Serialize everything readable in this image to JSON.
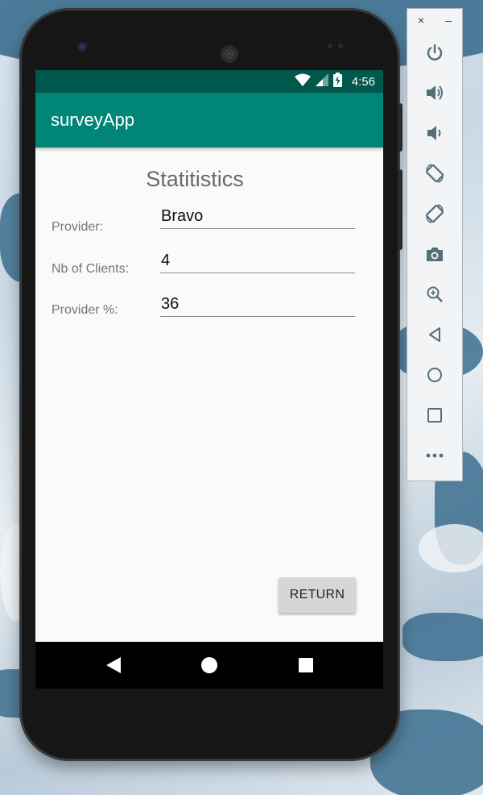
{
  "status_bar": {
    "time": "4:56",
    "icons": [
      "wifi-icon",
      "cell-signal-icon",
      "battery-charging-icon"
    ]
  },
  "app_bar": {
    "title": "surveyApp"
  },
  "screen": {
    "heading": "Statitistics",
    "fields": [
      {
        "label": "Provider:",
        "value": "Bravo"
      },
      {
        "label": "Nb of Clients:",
        "value": "4"
      },
      {
        "label": "Provider %:",
        "value": "36"
      }
    ],
    "return_button": "RETURN"
  },
  "nav_bar": {
    "icons": [
      "back-icon",
      "home-icon",
      "recents-icon"
    ]
  },
  "emulator_toolbar": {
    "window_controls": [
      "×",
      "–"
    ],
    "buttons": [
      "power-icon",
      "volume-up-icon",
      "volume-down-icon",
      "rotate-left-icon",
      "rotate-right-icon",
      "camera-icon",
      "zoom-icon",
      "back-icon",
      "home-icon",
      "overview-icon",
      "more-icon"
    ]
  },
  "colors": {
    "primary_dark": "#00574b",
    "primary": "#008577",
    "button_bg": "#d6d6d6",
    "toolbar_icon": "#546e7a"
  }
}
